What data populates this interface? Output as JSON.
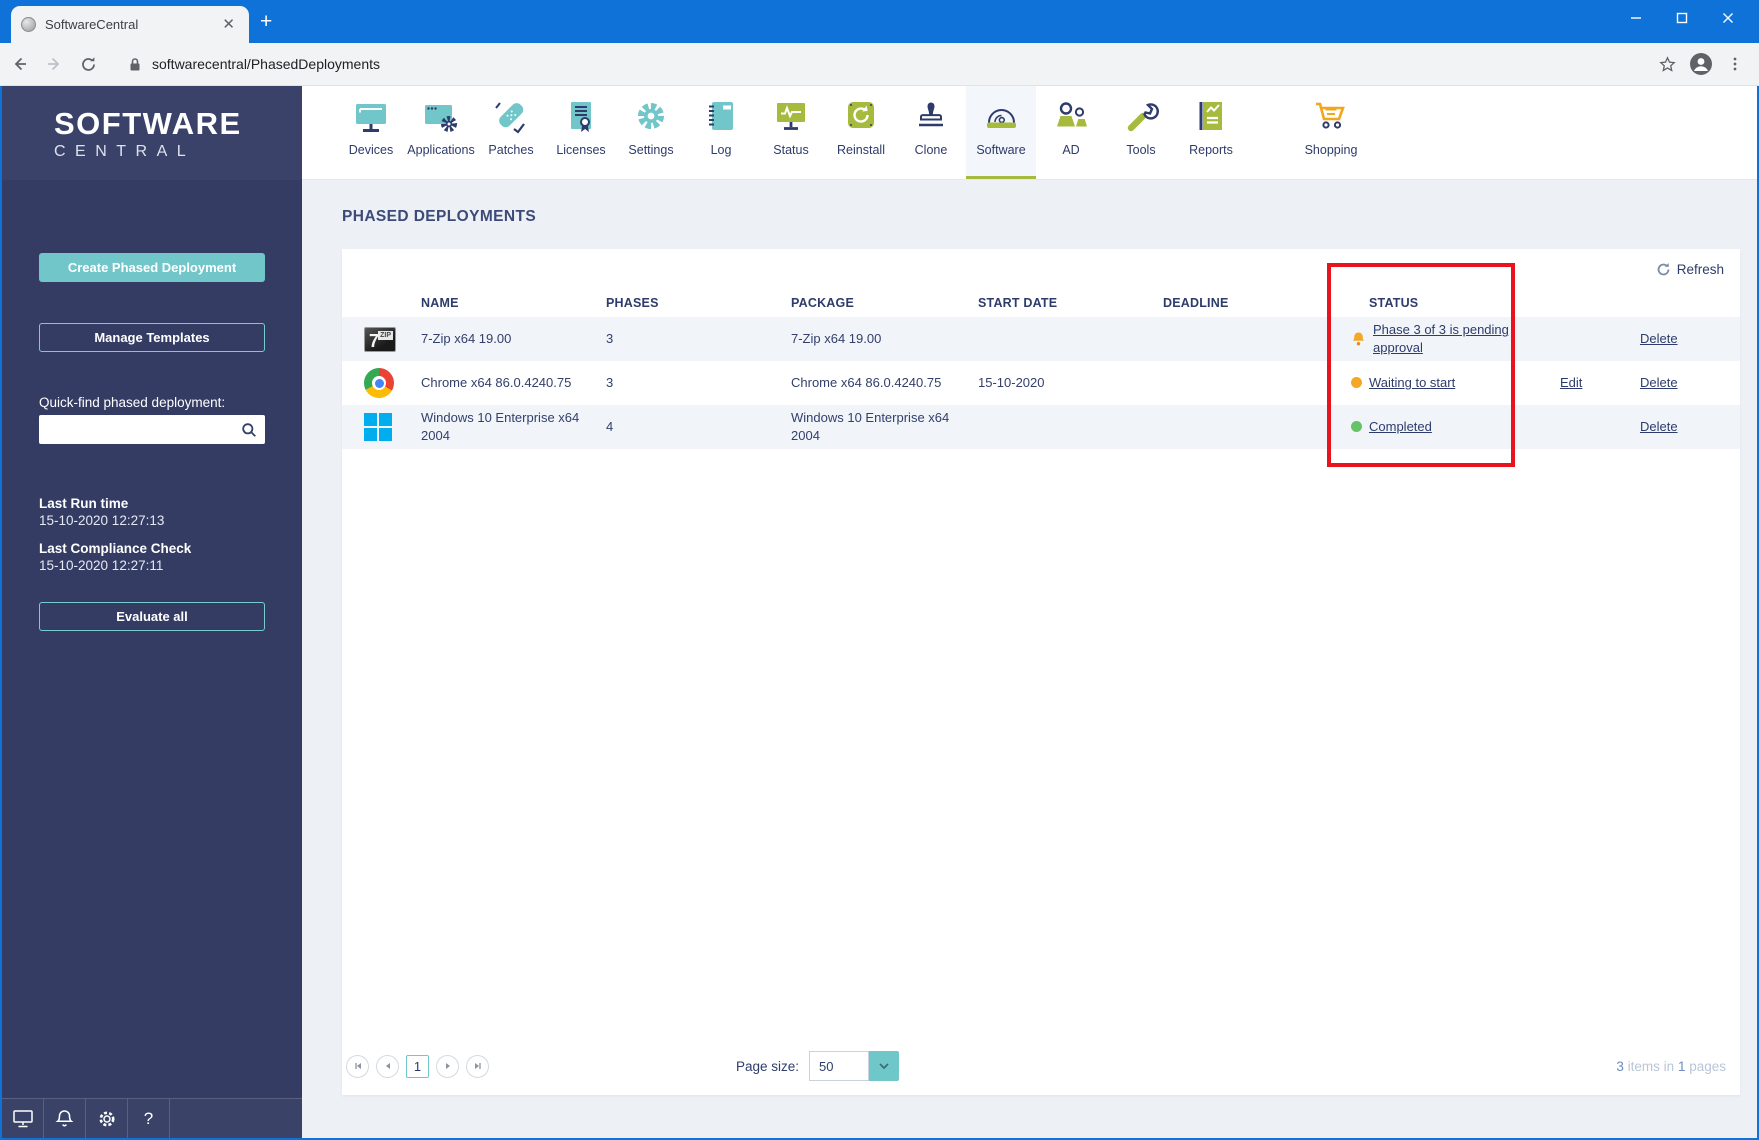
{
  "browser": {
    "tab_title": "SoftwareCentral",
    "url": "softwarecentral/PhasedDeployments"
  },
  "top_nav": {
    "items": [
      {
        "label": "Devices"
      },
      {
        "label": "Applications"
      },
      {
        "label": "Patches"
      },
      {
        "label": "Licenses"
      },
      {
        "label": "Settings"
      },
      {
        "label": "Log"
      },
      {
        "label": "Status"
      },
      {
        "label": "Reinstall"
      },
      {
        "label": "Clone"
      },
      {
        "label": "Software",
        "active": true
      },
      {
        "label": "AD"
      },
      {
        "label": "Tools"
      },
      {
        "label": "Reports"
      },
      {
        "label": "Shopping"
      }
    ]
  },
  "sidebar": {
    "logo_line1": "SOFTWARE",
    "logo_line2": "CENTRAL",
    "create_button": "Create Phased Deployment",
    "manage_button": "Manage Templates",
    "quickfind_label": "Quick-find phased deployment:",
    "last_run_label": "Last Run time",
    "last_run_value": "15-10-2020 12:27:13",
    "last_compliance_label": "Last Compliance Check",
    "last_compliance_value": "15-10-2020 12:27:11",
    "evaluate_button": "Evaluate all"
  },
  "main": {
    "title": "PHASED DEPLOYMENTS",
    "refresh_label": "Refresh",
    "table": {
      "headers": {
        "name": "NAME",
        "phases": "PHASES",
        "package": "PACKAGE",
        "start_date": "START DATE",
        "deadline": "DEADLINE",
        "status": "STATUS"
      },
      "rows": [
        {
          "app_icon": "7zip-icon",
          "name": "7-Zip x64 19.00",
          "phases": "3",
          "package": "7-Zip x64 19.00",
          "start_date": "",
          "deadline": "",
          "status": "Phase 3 of 3 is pending approval",
          "status_icon": "bell-icon",
          "status_color": "#f5a623",
          "delete_label": "Delete"
        },
        {
          "app_icon": "chrome-icon",
          "name": "Chrome x64 86.0.4240.75",
          "phases": "3",
          "package": "Chrome x64 86.0.4240.75",
          "start_date": "15-10-2020",
          "deadline": "",
          "status": "Waiting to start",
          "status_icon": "dot-icon",
          "status_color": "#f5a623",
          "edit_label": "Edit",
          "delete_label": "Delete"
        },
        {
          "app_icon": "windows-icon",
          "name": "Windows 10 Enterprise x64 2004",
          "phases": "4",
          "package": "Windows 10 Enterprise x64 2004",
          "start_date": "",
          "deadline": "",
          "status": "Completed",
          "status_icon": "dot-icon",
          "status_color": "#65c467",
          "delete_label": "Delete"
        }
      ]
    },
    "annotation": {
      "shape": "red-rectangle",
      "color": "#e8131c",
      "target": "status-column"
    },
    "pagination": {
      "current_page": "1",
      "page_size_label": "Page size:",
      "page_size_value": "50",
      "summary_count": "3",
      "summary_mid": " items in ",
      "summary_pages": "1",
      "summary_end": " pages"
    }
  },
  "colors": {
    "titlebar_blue": "#0e72d8",
    "sidebar_navy": "#343c64",
    "teal_accent": "#70c6c9",
    "olive_accent": "#a6bb3e",
    "navy_text": "#2e3b6b",
    "pending_orange": "#f5a623",
    "completed_green": "#65c467",
    "annotation_red": "#e8131c"
  }
}
